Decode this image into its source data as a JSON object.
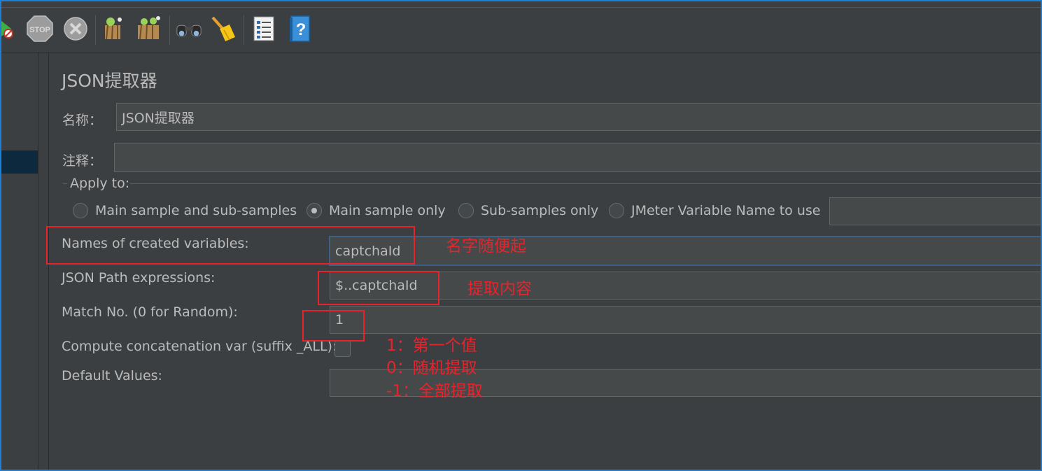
{
  "toolbar": {
    "icons": [
      "start-no-pauses-icon",
      "stop-icon",
      "shutdown-icon",
      "clear-icon",
      "clear-all-icon",
      "search-icon",
      "reset-search-icon",
      "function-helper-icon",
      "help-icon"
    ],
    "stop_text": "STOP"
  },
  "panel": {
    "title": "JSON提取器",
    "name_label": "名称：",
    "name_value": "JSON提取器",
    "comment_label": "注释：",
    "comment_value": "",
    "apply_to": {
      "label": "Apply to:",
      "options": [
        "Main sample and sub-samples",
        "Main sample only",
        "Sub-samples only",
        "JMeter Variable Name to use"
      ],
      "selected": "Main sample only",
      "variable_value": ""
    },
    "fields": {
      "names_label": "Names of created variables:",
      "names_value": "captchaId",
      "path_label": "JSON Path expressions:",
      "path_value": "$..captchaId",
      "match_label": "Match No. (0 for Random):",
      "match_value": "1",
      "concat_label": "Compute concatenation var (suffix _ALL):",
      "concat_checked": false,
      "default_label": "Default Values:",
      "default_value": ""
    }
  },
  "annotations": {
    "name_note": "名字随便起",
    "path_note": "提取内容",
    "match_notes": [
      "1：第一个值",
      "0：随机提取",
      "-1：全部提取"
    ],
    "color": "#e8232b"
  }
}
